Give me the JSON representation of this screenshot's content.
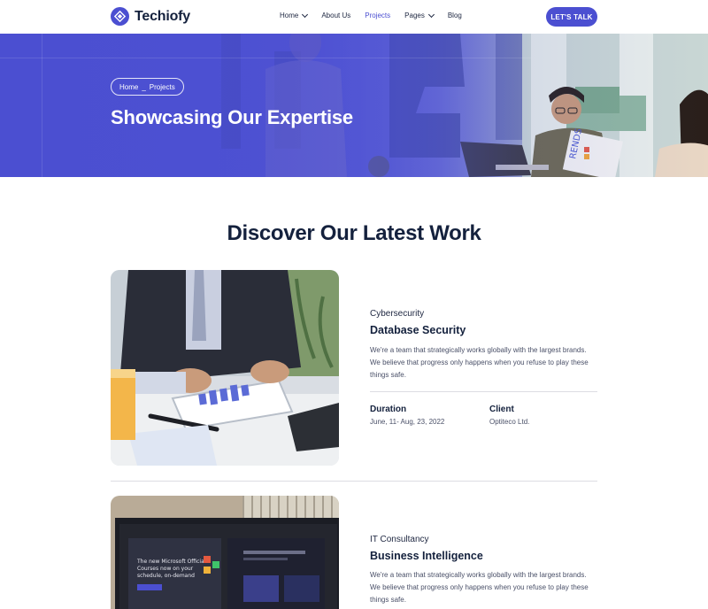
{
  "brand": {
    "name": "Techiofy",
    "accent": "#4b4fd1"
  },
  "nav": {
    "items": [
      {
        "label": "Home",
        "has_dropdown": true,
        "active": false
      },
      {
        "label": "About Us",
        "has_dropdown": false,
        "active": false
      },
      {
        "label": "Projects",
        "has_dropdown": false,
        "active": true
      },
      {
        "label": "Pages",
        "has_dropdown": true,
        "active": false
      },
      {
        "label": "Blog",
        "has_dropdown": false,
        "active": false
      }
    ],
    "cta_label": "LET'S TALK"
  },
  "hero": {
    "breadcrumb": {
      "home": "Home",
      "separator": "_",
      "current": "Projects"
    },
    "title": "Showcasing Our Expertise"
  },
  "section": {
    "title": "Discover Our Latest Work"
  },
  "projects": [
    {
      "category": "Cybersecurity",
      "title": "Database Security",
      "description": "We're a team that strategically works globally with the largest brands. We believe that progress only happens when you refuse to play these things safe.",
      "duration_label": "Duration",
      "duration_value": "June, 11- Aug, 23, 2022",
      "client_label": "Client",
      "client_value": "Optiteco Ltd."
    },
    {
      "category": "IT Consultancy",
      "title": "Business Intelligence",
      "description": "We're a team that strategically works globally with the largest brands. We believe that progress only happens when you refuse to play these things safe."
    }
  ]
}
